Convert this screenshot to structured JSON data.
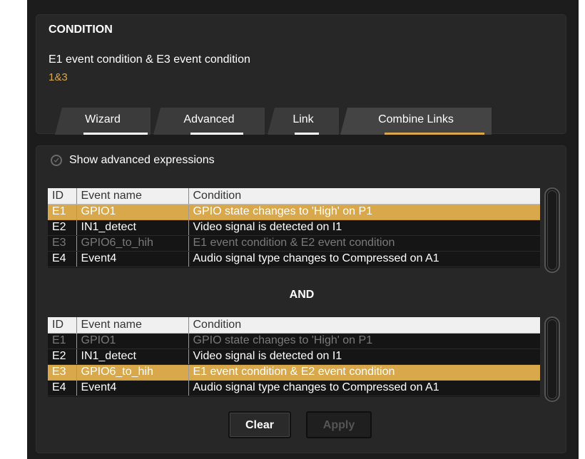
{
  "condition": {
    "title": "CONDITION",
    "expression": "E1 event condition & E3 event condition",
    "formula": "1&3"
  },
  "tabs": [
    {
      "label": "Wizard",
      "active": false
    },
    {
      "label": "Advanced",
      "active": false
    },
    {
      "label": "Link",
      "active": false
    },
    {
      "label": "Combine Links",
      "active": true
    }
  ],
  "show_advanced": {
    "label": "Show advanced expressions",
    "checked": false
  },
  "columns": [
    "ID",
    "Event name",
    "Condition"
  ],
  "table1": {
    "rows": [
      {
        "id": "E1",
        "name": "GPIO1",
        "condition": "GPIO state changes to 'High' on P1",
        "state": "selected"
      },
      {
        "id": "E2",
        "name": "IN1_detect",
        "condition": "Video signal is detected on I1",
        "state": "normal"
      },
      {
        "id": "E3",
        "name": "GPIO6_to_hih",
        "condition": "E1 event condition & E2 event condition",
        "state": "disabled"
      },
      {
        "id": "E4",
        "name": "Event4",
        "condition": "Audio signal type changes to Compressed on A1",
        "state": "cut"
      }
    ]
  },
  "operator": "AND",
  "table2": {
    "rows": [
      {
        "id": "E1",
        "name": "GPIO1",
        "condition": "GPIO state changes to 'High' on P1",
        "state": "disabled"
      },
      {
        "id": "E2",
        "name": "IN1_detect",
        "condition": "Video signal is detected on I1",
        "state": "normal"
      },
      {
        "id": "E3",
        "name": "GPIO6_to_hih",
        "condition": "E1 event condition & E2 event condition",
        "state": "selected"
      },
      {
        "id": "E4",
        "name": "Event4",
        "condition": "Audio signal type changes to Compressed on A1",
        "state": "cut"
      }
    ]
  },
  "buttons": {
    "clear": "Clear",
    "apply": "Apply"
  },
  "colors": {
    "accent": "#d9a84a",
    "background": "#1c1c1c",
    "panel": "#272727"
  }
}
